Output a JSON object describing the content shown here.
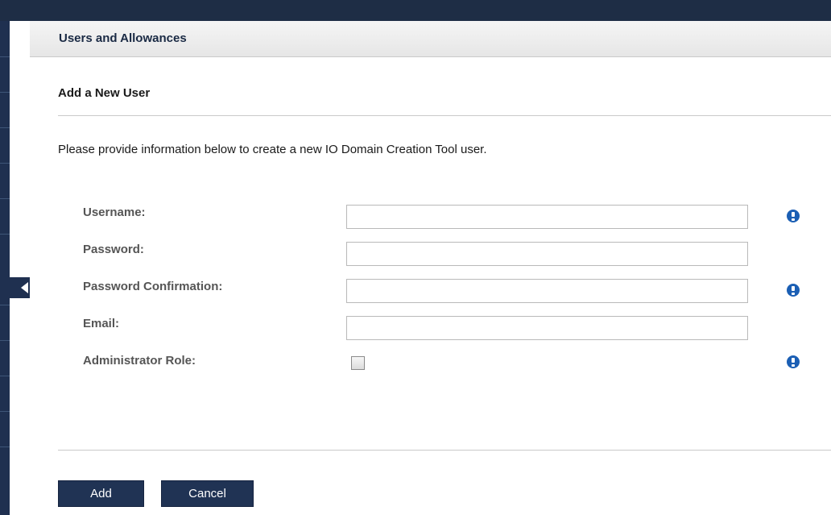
{
  "header": {
    "title": "Users and Allowances"
  },
  "form": {
    "section_title": "Add a New User",
    "intro": "Please provide information below to create a new IO Domain Creation Tool user.",
    "fields": {
      "username": {
        "label": "Username:",
        "value": "",
        "required": true
      },
      "password": {
        "label": "Password:",
        "value": "",
        "required": false
      },
      "password_confirmation": {
        "label": "Password Confirmation:",
        "value": "",
        "required": true
      },
      "email": {
        "label": "Email:",
        "value": "",
        "required": false
      },
      "administrator_role": {
        "label": "Administrator Role:",
        "checked": false,
        "required": true
      }
    },
    "buttons": {
      "add": "Add",
      "cancel": "Cancel"
    }
  },
  "icons": {
    "required_indicator": "info-icon",
    "rail_selected": "arrow-left-icon"
  },
  "colors": {
    "nav_dark": "#1f3050",
    "button": "#203354",
    "info_blue": "#1b5fb4",
    "label_gray": "#555555"
  }
}
